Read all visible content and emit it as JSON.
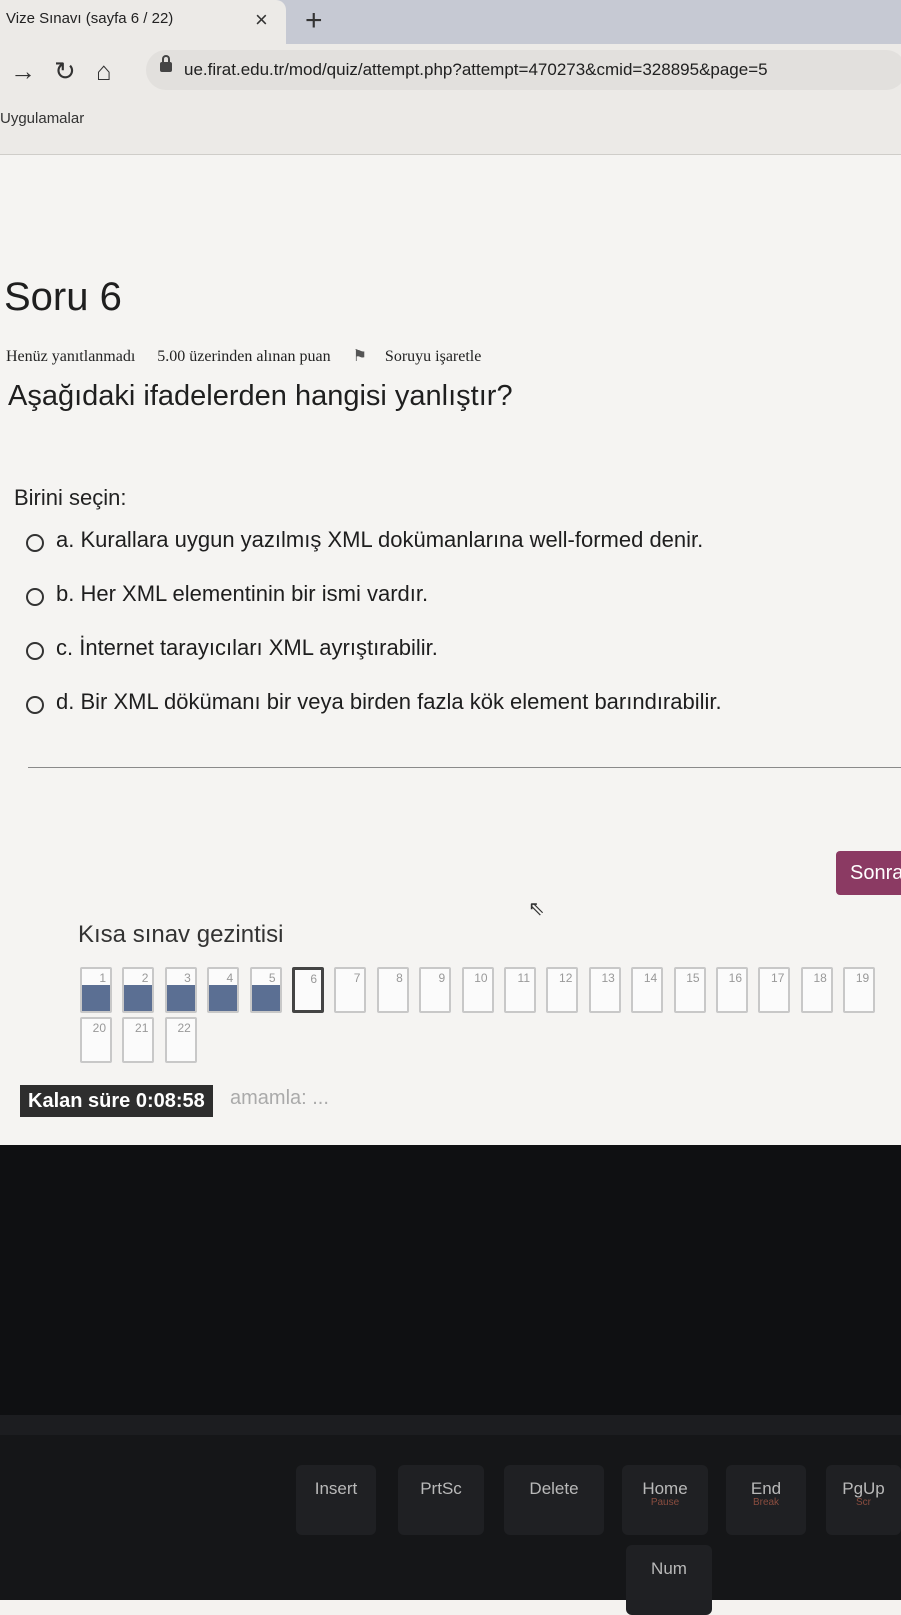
{
  "browser": {
    "tab_title": "Vize Sınavı (sayfa 6 / 22)",
    "tab_close": "×",
    "new_tab": "+",
    "url": "ue.firat.edu.tr/mod/quiz/attempt.php?attempt=470273&cmid=328895&page=5",
    "bookmarks_apps": "Uygulamalar"
  },
  "question": {
    "title": "Soru 6",
    "status": "Henüz yanıtlanmadı",
    "points": "5.00 üzerinden alınan puan",
    "flag_label": "Soruyu işaretle",
    "text": "Aşağıdaki ifadelerden hangisi yanlıştır?",
    "prompt": "Birini seçin:",
    "options": [
      {
        "label": "a. Kurallara uygun yazılmış XML dokümanlarına well-formed denir."
      },
      {
        "label": "b. Her XML elementinin bir ismi vardır."
      },
      {
        "label": "c. İnternet tarayıcıları XML ayrıştırabilir."
      },
      {
        "label": "d. Bir XML dökümanı bir veya birden fazla kök element barındırabilir."
      }
    ]
  },
  "next_button": "Sonra",
  "quiz_nav": {
    "title": "Kısa sınav gezintisi",
    "items": [
      {
        "n": "1",
        "state": "answered"
      },
      {
        "n": "2",
        "state": "answered"
      },
      {
        "n": "3",
        "state": "answered"
      },
      {
        "n": "4",
        "state": "answered"
      },
      {
        "n": "5",
        "state": "answered"
      },
      {
        "n": "6",
        "state": "current"
      },
      {
        "n": "7",
        "state": "empty"
      },
      {
        "n": "8",
        "state": "empty"
      },
      {
        "n": "9",
        "state": "empty"
      },
      {
        "n": "10",
        "state": "empty"
      },
      {
        "n": "11",
        "state": "empty"
      },
      {
        "n": "12",
        "state": "empty"
      },
      {
        "n": "13",
        "state": "empty"
      },
      {
        "n": "14",
        "state": "empty"
      },
      {
        "n": "15",
        "state": "empty"
      },
      {
        "n": "16",
        "state": "empty"
      },
      {
        "n": "17",
        "state": "empty"
      },
      {
        "n": "18",
        "state": "empty"
      },
      {
        "n": "19",
        "state": "empty"
      },
      {
        "n": "20",
        "state": "empty"
      },
      {
        "n": "21",
        "state": "empty"
      },
      {
        "n": "22",
        "state": "empty"
      }
    ]
  },
  "timer": "Kalan süre 0:08:58",
  "finish_link": "amamla: ...",
  "keyboard": {
    "keys": [
      {
        "label": "Insert",
        "sub": ""
      },
      {
        "label": "PrtSc",
        "sub": ""
      },
      {
        "label": "Delete",
        "sub": ""
      },
      {
        "label": "Home",
        "sub": "Pause"
      },
      {
        "label": "End",
        "sub": "Break"
      },
      {
        "label": "PgUp",
        "sub": "Scr"
      },
      {
        "label": "Num",
        "sub": ""
      }
    ]
  }
}
